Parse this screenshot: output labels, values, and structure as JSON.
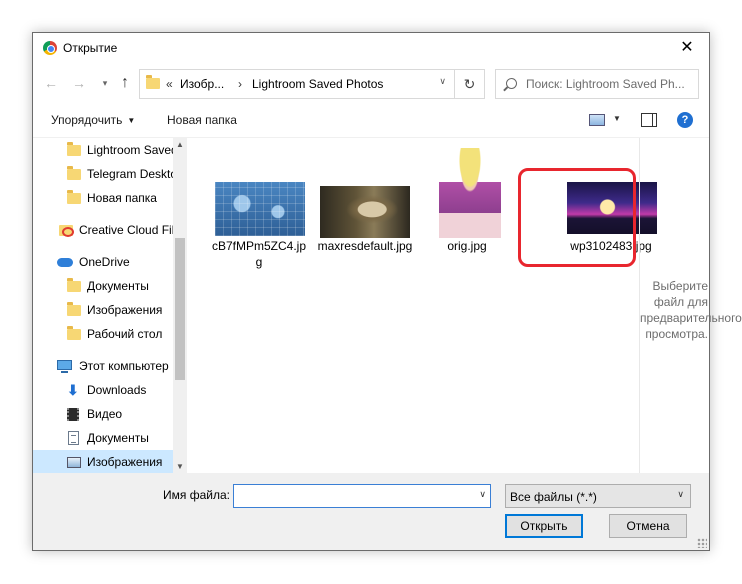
{
  "dialog": {
    "title": "Открытие",
    "close_glyph": "✕"
  },
  "nav": {
    "back_glyph": "←",
    "forward_glyph": "→",
    "recent_glyph": "▾",
    "up_glyph": "↑",
    "address": {
      "overflow_glyph": "«",
      "parts": [
        "Изобр...",
        "Lightroom Saved Photos"
      ],
      "separator": "›",
      "dropdown_glyph": "∨",
      "refresh_glyph": "↻"
    },
    "search": {
      "placeholder": "Поиск: Lightroom Saved Ph..."
    }
  },
  "toolbar": {
    "organize_label": "Упорядочить",
    "organize_arrow": "▼",
    "new_folder_label": "Новая папка",
    "view_dropdown_glyph": "▼",
    "help_glyph": "?"
  },
  "sidebar": {
    "items": [
      {
        "label": "Lightroom Saved",
        "icon": "folder-icon"
      },
      {
        "label": "Telegram Deskto",
        "icon": "folder-icon"
      },
      {
        "label": "Новая папка",
        "icon": "folder-icon"
      },
      {
        "label": "Creative Cloud Fil",
        "icon": "creative-cloud-folder-icon"
      },
      {
        "label": "OneDrive",
        "icon": "onedrive-cloud-icon"
      },
      {
        "label": "Документы",
        "icon": "folder-icon"
      },
      {
        "label": "Изображения",
        "icon": "folder-icon"
      },
      {
        "label": "Рабочий стол",
        "icon": "folder-icon"
      },
      {
        "label": "Этот компьютер",
        "icon": "computer-icon"
      },
      {
        "label": "Downloads",
        "icon": "download-arrow-icon"
      },
      {
        "label": "Видео",
        "icon": "video-icon"
      },
      {
        "label": "Документы",
        "icon": "documents-icon"
      },
      {
        "label": "Изображения",
        "icon": "pictures-icon"
      }
    ],
    "selected_index": 12,
    "scroll_up_glyph": "▲",
    "scroll_down_glyph": "▼"
  },
  "files": [
    {
      "name": "cB7fMPm5ZC4.jpg"
    },
    {
      "name": "maxresdefault.jpg"
    },
    {
      "name": "orig.jpg"
    },
    {
      "name": "wp3102483.jpg"
    }
  ],
  "preview": {
    "text": "Выберите файл для предварительного просмотра."
  },
  "bottom": {
    "filename_label": "Имя файла:",
    "filename_value": "",
    "filename_dropdown_glyph": "∨",
    "filter_value": "Все файлы (*.*)",
    "filter_dropdown_glyph": "∨",
    "open_label": "Открыть",
    "cancel_label": "Отмена"
  },
  "colors": {
    "selection": "#cce8ff",
    "highlight_frame": "#e8262e",
    "primary_button_border": "#0078d7"
  }
}
